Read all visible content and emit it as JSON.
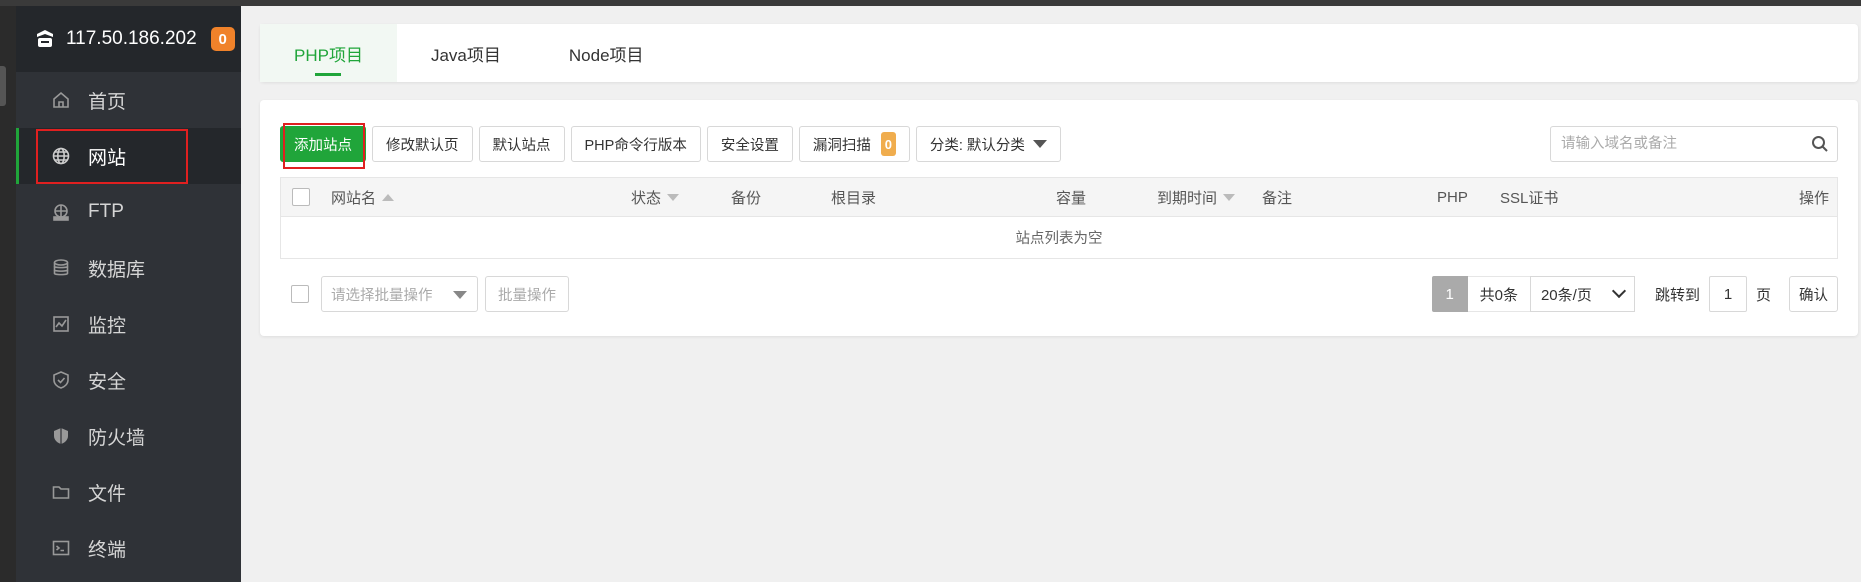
{
  "server": {
    "ip": "117.50.186.202",
    "badge": "0"
  },
  "sidebar": {
    "items": [
      {
        "label": "首页",
        "icon": "home-icon"
      },
      {
        "label": "网站",
        "icon": "globe-icon",
        "active": true
      },
      {
        "label": "FTP",
        "icon": "ftp-icon"
      },
      {
        "label": "数据库",
        "icon": "database-icon"
      },
      {
        "label": "监控",
        "icon": "monitor-icon"
      },
      {
        "label": "安全",
        "icon": "shield-icon"
      },
      {
        "label": "防火墙",
        "icon": "firewall-icon"
      },
      {
        "label": "文件",
        "icon": "folder-icon"
      },
      {
        "label": "终端",
        "icon": "terminal-icon"
      }
    ]
  },
  "tabs": [
    {
      "label": "PHP项目",
      "active": true
    },
    {
      "label": "Java项目"
    },
    {
      "label": "Node项目"
    }
  ],
  "toolbar": {
    "add_site": "添加站点",
    "modify_default_page": "修改默认页",
    "default_site": "默认站点",
    "php_cli_version": "PHP命令行版本",
    "security_settings": "安全设置",
    "vuln_scan": "漏洞扫描",
    "vuln_count": "0",
    "category": "分类: 默认分类"
  },
  "search": {
    "placeholder": "请输入域名或备注"
  },
  "table": {
    "columns": {
      "site_name": "网站名",
      "status": "状态",
      "backup": "备份",
      "root_dir": "根目录",
      "capacity": "容量",
      "expiry": "到期时间",
      "remark": "备注",
      "php": "PHP",
      "ssl": "SSL证书",
      "actions": "操作"
    },
    "empty_message": "站点列表为空"
  },
  "footer": {
    "batch_placeholder": "请选择批量操作",
    "batch_button": "批量操作",
    "current_page": "1",
    "total": "共0条",
    "page_size": "20条/页",
    "jump_label": "跳转到",
    "jump_value": "1",
    "page_unit": "页",
    "confirm": "确认"
  },
  "colors": {
    "accent": "#20a53a",
    "sidebar_bg": "#2f3237",
    "badge": "#f0822a",
    "highlight": "#e02020"
  }
}
